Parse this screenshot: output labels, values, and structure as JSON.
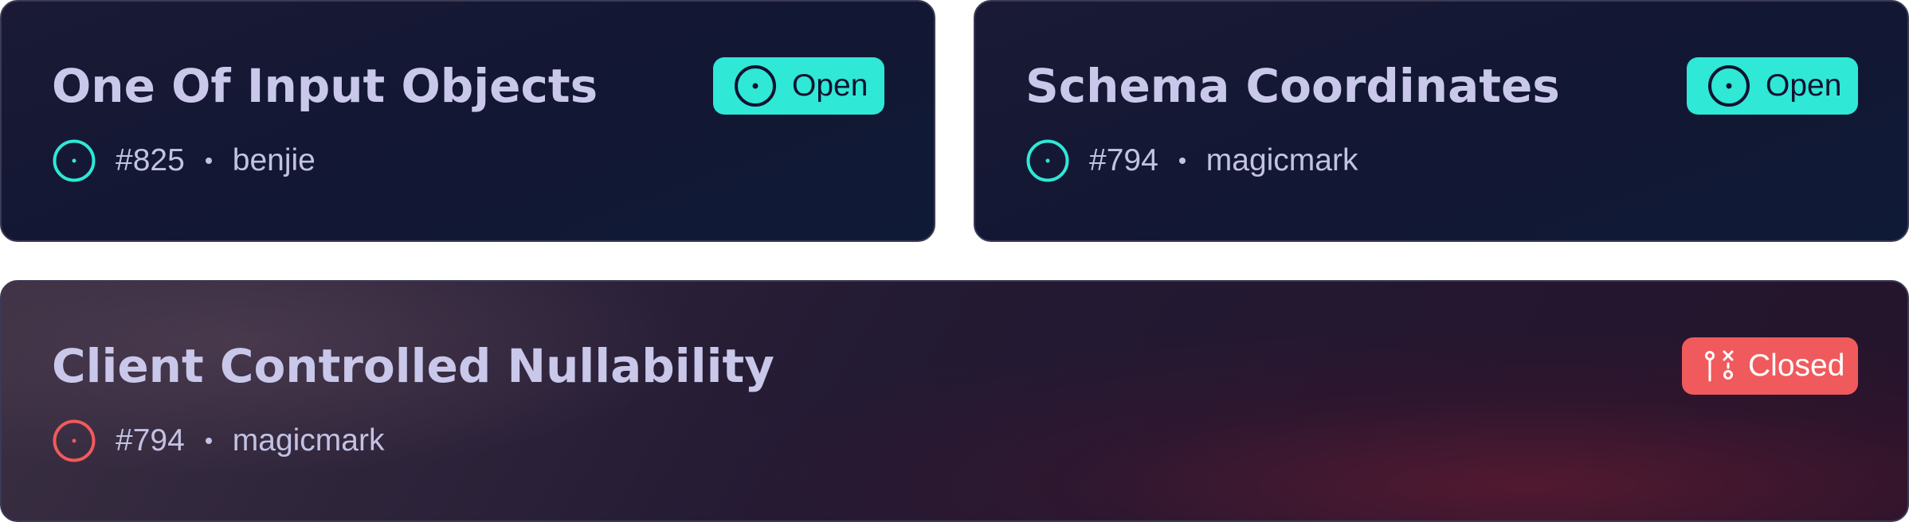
{
  "colors": {
    "open_accent": "#2fe8d6",
    "closed_accent": "#f05a5c",
    "title_text": "#c9c8ea",
    "meta_text": "#c3c2e3",
    "open_badge_text": "#101230",
    "closed_badge_text": "#ffffff"
  },
  "cards": [
    {
      "title": "One Of Input Objects",
      "number": "#825",
      "author": "benjie",
      "status": "Open",
      "status_icon": "issue-open-icon"
    },
    {
      "title": "Schema Coordinates",
      "number": "#794",
      "author": "magicmark",
      "status": "Open",
      "status_icon": "issue-open-icon"
    },
    {
      "title": "Client Controlled Nullability",
      "number": "#794",
      "author": "magicmark",
      "status": "Closed",
      "status_icon": "git-pull-request-closed-icon"
    }
  ]
}
